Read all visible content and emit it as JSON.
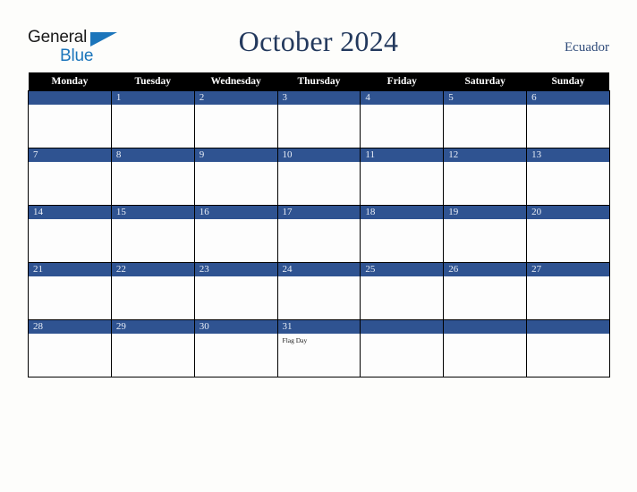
{
  "header": {
    "logo": {
      "word1": "General",
      "word2": "Blue",
      "triangle_color": "#1b75bb",
      "icon": "logo-triangle-icon"
    },
    "title": "October 2024",
    "country": "Ecuador"
  },
  "colors": {
    "day_bar": "#2f5391",
    "weekday_header_bg": "#000000",
    "title_color": "#23395d",
    "country_color": "#2f4b79",
    "page_bg": "#fdfdfb",
    "cell_bg": "#fdfdfd",
    "grid_line": "#000000"
  },
  "calendar": {
    "month": "October",
    "year": "2024",
    "weekday_headers": [
      "Monday",
      "Tuesday",
      "Wednesday",
      "Thursday",
      "Friday",
      "Saturday",
      "Sunday"
    ],
    "weeks": [
      [
        {
          "number": "",
          "events": []
        },
        {
          "number": "1",
          "events": []
        },
        {
          "number": "2",
          "events": []
        },
        {
          "number": "3",
          "events": []
        },
        {
          "number": "4",
          "events": []
        },
        {
          "number": "5",
          "events": []
        },
        {
          "number": "6",
          "events": []
        }
      ],
      [
        {
          "number": "7",
          "events": []
        },
        {
          "number": "8",
          "events": []
        },
        {
          "number": "9",
          "events": []
        },
        {
          "number": "10",
          "events": []
        },
        {
          "number": "11",
          "events": []
        },
        {
          "number": "12",
          "events": []
        },
        {
          "number": "13",
          "events": []
        }
      ],
      [
        {
          "number": "14",
          "events": []
        },
        {
          "number": "15",
          "events": []
        },
        {
          "number": "16",
          "events": []
        },
        {
          "number": "17",
          "events": []
        },
        {
          "number": "18",
          "events": []
        },
        {
          "number": "19",
          "events": []
        },
        {
          "number": "20",
          "events": []
        }
      ],
      [
        {
          "number": "21",
          "events": []
        },
        {
          "number": "22",
          "events": []
        },
        {
          "number": "23",
          "events": []
        },
        {
          "number": "24",
          "events": []
        },
        {
          "number": "25",
          "events": []
        },
        {
          "number": "26",
          "events": []
        },
        {
          "number": "27",
          "events": []
        }
      ],
      [
        {
          "number": "28",
          "events": []
        },
        {
          "number": "29",
          "events": []
        },
        {
          "number": "30",
          "events": []
        },
        {
          "number": "31",
          "events": [
            "Flag Day"
          ]
        },
        {
          "number": "",
          "events": []
        },
        {
          "number": "",
          "events": []
        },
        {
          "number": "",
          "events": []
        }
      ]
    ]
  }
}
